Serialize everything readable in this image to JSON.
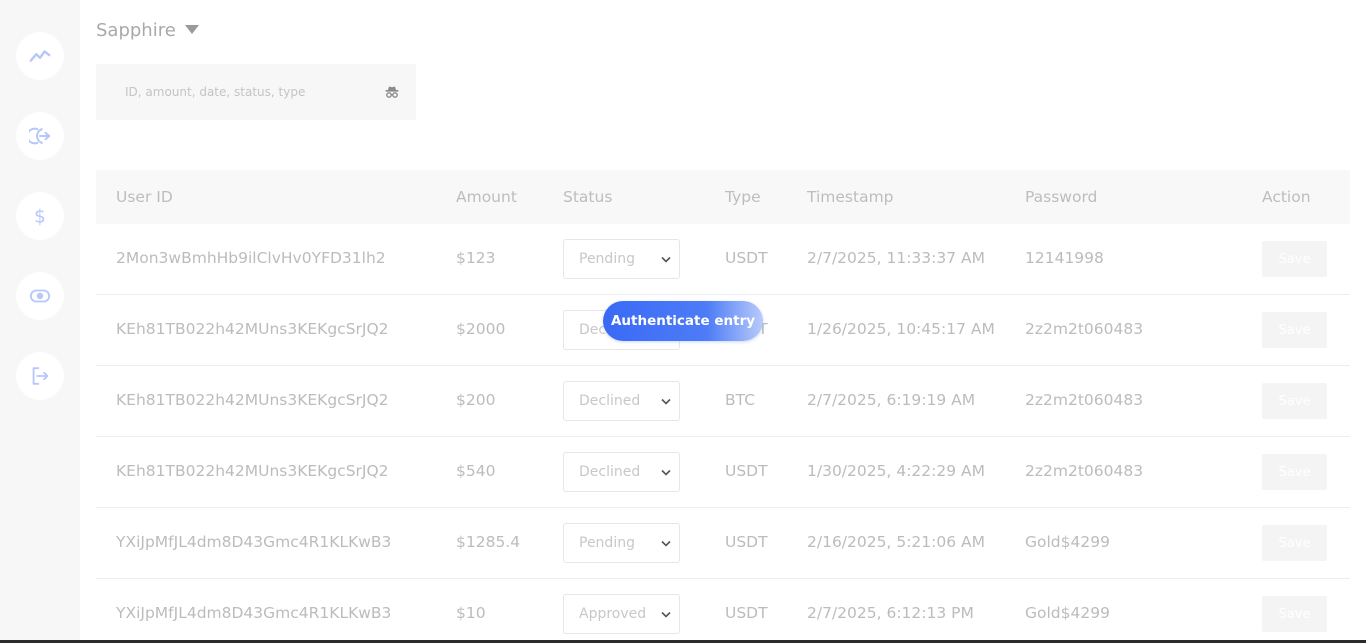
{
  "colors": {
    "sidebar_bg": "#f7f7f7",
    "icon_blue": "#b5c7fb",
    "accent_blue": "#3a6af5",
    "muted_text": "#bcbcbc"
  },
  "sidebar": {
    "items": [
      {
        "icon": "trend-line-icon"
      },
      {
        "icon": "login-arrow-icon"
      },
      {
        "icon": "dollar-icon"
      },
      {
        "icon": "eye-icon"
      },
      {
        "icon": "logout-icon"
      }
    ]
  },
  "workspace": {
    "name": "Sapphire"
  },
  "search": {
    "placeholder": "ID, amount, date, status, type",
    "value": "",
    "icon": "spy-icon"
  },
  "table": {
    "columns": [
      "User ID",
      "Amount",
      "Status",
      "Type",
      "Timestamp",
      "Password",
      "Action"
    ],
    "rows": [
      {
        "user_id": "2Mon3wBmhHb9ilClvHv0YFD31lh2",
        "amount": "$123",
        "status": "Pending",
        "type": "USDT",
        "timestamp": "2/7/2025, 11:33:37 AM",
        "password": "12141998",
        "action": "Save"
      },
      {
        "user_id": "KEh81TB022h42MUns3KEKgcSrJQ2",
        "amount": "$2000",
        "status": "Declined",
        "type": "USDT",
        "timestamp": "1/26/2025, 10:45:17 AM",
        "password": "2z2m2t060483",
        "action": "Save"
      },
      {
        "user_id": "KEh81TB022h42MUns3KEKgcSrJQ2",
        "amount": "$200",
        "status": "Declined",
        "type": "BTC",
        "timestamp": "2/7/2025, 6:19:19 AM",
        "password": "2z2m2t060483",
        "action": "Save"
      },
      {
        "user_id": "KEh81TB022h42MUns3KEKgcSrJQ2",
        "amount": "$540",
        "status": "Declined",
        "type": "USDT",
        "timestamp": "1/30/2025, 4:22:29 AM",
        "password": "2z2m2t060483",
        "action": "Save"
      },
      {
        "user_id": "YXiJpMfJL4dm8D43Gmc4R1KLKwB3",
        "amount": "$1285.4",
        "status": "Pending",
        "type": "USDT",
        "timestamp": "2/16/2025, 5:21:06 AM",
        "password": "Gold$4299",
        "action": "Save"
      },
      {
        "user_id": "YXiJpMfJL4dm8D43Gmc4R1KLKwB3",
        "amount": "$10",
        "status": "Approved",
        "type": "USDT",
        "timestamp": "2/7/2025, 6:12:13 PM",
        "password": "Gold$4299",
        "action": "Save"
      }
    ]
  },
  "overlay_button": {
    "label": "Authenticate entry"
  }
}
